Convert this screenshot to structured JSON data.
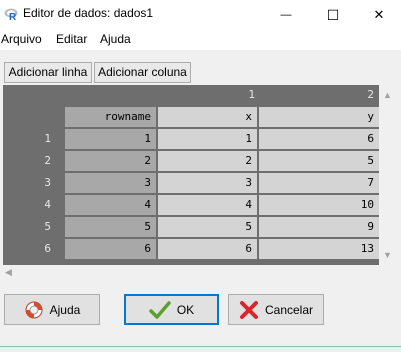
{
  "window": {
    "title": "Editor de dados: dados1",
    "minimize_glyph": "—",
    "maximize_glyph": "☐",
    "close_glyph": "✕"
  },
  "menu": {
    "items": [
      {
        "label": "Arquivo"
      },
      {
        "label": "Editar"
      },
      {
        "label": "Ajuda"
      }
    ]
  },
  "toolbar": {
    "add_row_label": "Adicionar linha",
    "add_column_label": "Adicionar coluna"
  },
  "grid": {
    "column_numbers": [
      "1",
      "2"
    ],
    "headers": [
      "rowname",
      "x",
      "y"
    ],
    "rows": [
      {
        "num": "1",
        "cells": [
          "1",
          "1",
          "6"
        ]
      },
      {
        "num": "2",
        "cells": [
          "2",
          "2",
          "5"
        ]
      },
      {
        "num": "3",
        "cells": [
          "3",
          "3",
          "7"
        ]
      },
      {
        "num": "4",
        "cells": [
          "4",
          "4",
          "10"
        ]
      },
      {
        "num": "5",
        "cells": [
          "5",
          "5",
          "9"
        ]
      },
      {
        "num": "6",
        "cells": [
          "6",
          "6",
          "13"
        ]
      }
    ]
  },
  "buttons": {
    "help_label": "Ajuda",
    "ok_label": "OK",
    "cancel_label": "Cancelar"
  },
  "colors": {
    "grid_background": "#6e6e6e",
    "rowname_cells": "#a8a8a8",
    "data_cells": "#d4d4d4",
    "ok_border": "#0078d7",
    "cancel_icon": "#d9262c",
    "ok_icon": "#5aa02c"
  }
}
